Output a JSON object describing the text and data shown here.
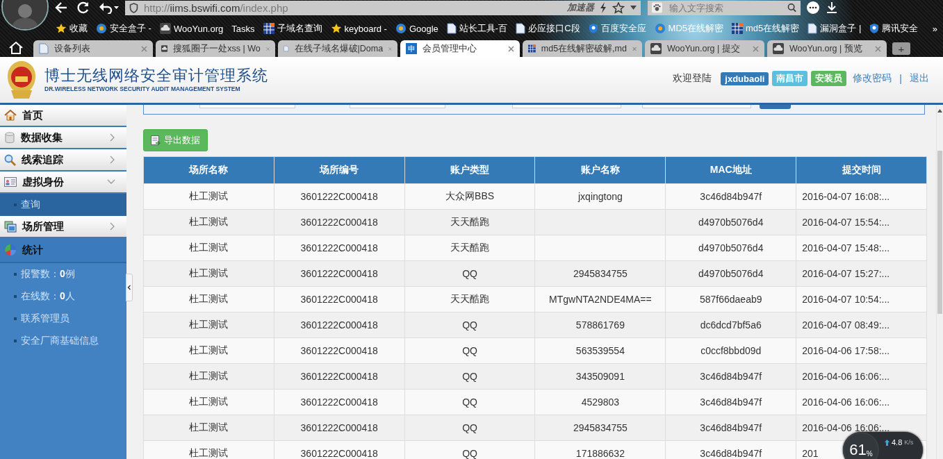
{
  "browser": {
    "url_scheme": "http://",
    "url_host": "iims.bswifi.com",
    "url_path": "/index.php",
    "accelerator": "加速器",
    "search": {
      "placeholder": "输入文字搜索"
    },
    "bookmarks": [
      "收藏",
      "安全盒子 -",
      "WooYun.org",
      "Tasks",
      "子域名查询",
      "keyboard -",
      "Google",
      "站长工具-百",
      "必应接口C段",
      "百度安全应",
      "MD5在线解密",
      "md5在线解密",
      "漏洞盒子 |",
      "腾讯安全"
    ],
    "more": "»",
    "tabs": [
      {
        "label": "设备列表",
        "selected": false
      },
      {
        "label": "搜狐圈子一处xss | Wo",
        "selected": false
      },
      {
        "label": "在线子域名爆破|Doma",
        "selected": false
      },
      {
        "label": "会员管理中心",
        "icon_text": "申",
        "selected": true
      },
      {
        "label": "md5在线解密破解,md",
        "selected": false
      },
      {
        "label": "WooYun.org | 提交",
        "selected": false
      },
      {
        "label": "WooYun.org | 预览",
        "selected": false
      }
    ],
    "new_tab": "+"
  },
  "header": {
    "title": "博士无线网络安全审计管理系统",
    "subtitle": "DR.WIRELESS NETWORK SECURITY AUDIT MANAGEMENT SYSTEM",
    "welcome": "欢迎登陆",
    "badges": [
      {
        "text": "jxdubaoli",
        "color": "#337ab7"
      },
      {
        "text": "南昌市",
        "color": "#5bc0de"
      },
      {
        "text": "安装员",
        "color": "#5cb85c"
      }
    ],
    "links": [
      "修改密码",
      "退出"
    ],
    "separator": "|"
  },
  "sidebar": {
    "items": [
      {
        "label": "首页",
        "kind": "menu"
      },
      {
        "label": "数据收集",
        "kind": "menu",
        "expanded": false
      },
      {
        "label": "线索追踪",
        "kind": "menu",
        "expanded": false
      },
      {
        "label": "虚拟身份",
        "kind": "menu",
        "expanded": true,
        "children": [
          {
            "label": "查询",
            "selected": true
          }
        ]
      },
      {
        "label": "场所管理",
        "kind": "menu",
        "expanded": false
      },
      {
        "label": "统计",
        "kind": "section",
        "children": [
          {
            "label": "报警数：**0**例"
          },
          {
            "label": "在线数：**0**人"
          },
          {
            "label": "联系管理员"
          },
          {
            "label": "安全厂商基础信息"
          }
        ]
      }
    ]
  },
  "export_button": "导出数据",
  "table": {
    "columns": [
      "场所名称",
      "场所编号",
      "账户类型",
      "账户名称",
      "MAC地址",
      "提交时间"
    ],
    "rows": [
      [
        "杜工测试",
        "3601222C000418",
        "大众网BBS",
        "jxqingtong",
        "3c46d84b947f",
        "2016-04-07 16:08:..."
      ],
      [
        "杜工测试",
        "3601222C000418",
        "天天酷跑",
        "",
        "d4970b5076d4",
        "2016-04-07 15:54:..."
      ],
      [
        "杜工测试",
        "3601222C000418",
        "天天酷跑",
        "",
        "d4970b5076d4",
        "2016-04-07 15:48:..."
      ],
      [
        "杜工测试",
        "3601222C000418",
        "QQ",
        "2945834755",
        "d4970b5076d4",
        "2016-04-07 15:27:..."
      ],
      [
        "杜工测试",
        "3601222C000418",
        "天天酷跑",
        "MTgwNTA2NDE4MA==",
        "587f66daeab9",
        "2016-04-07 10:54:..."
      ],
      [
        "杜工测试",
        "3601222C000418",
        "QQ",
        "578861769",
        "dc6dcd7bf5a6",
        "2016-04-07 08:49:..."
      ],
      [
        "杜工测试",
        "3601222C000418",
        "QQ",
        "563539554",
        "c0ccf8bbd09d",
        "2016-04-06 17:58:..."
      ],
      [
        "杜工测试",
        "3601222C000418",
        "QQ",
        "343509091",
        "3c46d84b947f",
        "2016-04-06 16:06:..."
      ],
      [
        "杜工测试",
        "3601222C000418",
        "QQ",
        "4529803",
        "3c46d84b947f",
        "2016-04-06 16:06:..."
      ],
      [
        "杜工测试",
        "3601222C000418",
        "QQ",
        "2945834755",
        "3c46d84b947f",
        "2016-04-06 16:06:..."
      ],
      [
        "杜工测试",
        "3601222C000418",
        "QQ",
        "171886632",
        "3c46d84b947f",
        "201"
      ]
    ]
  },
  "speed_widget": {
    "percent": "61",
    "percent_sign": "%",
    "upload": "4.8",
    "unit": "K/s"
  }
}
